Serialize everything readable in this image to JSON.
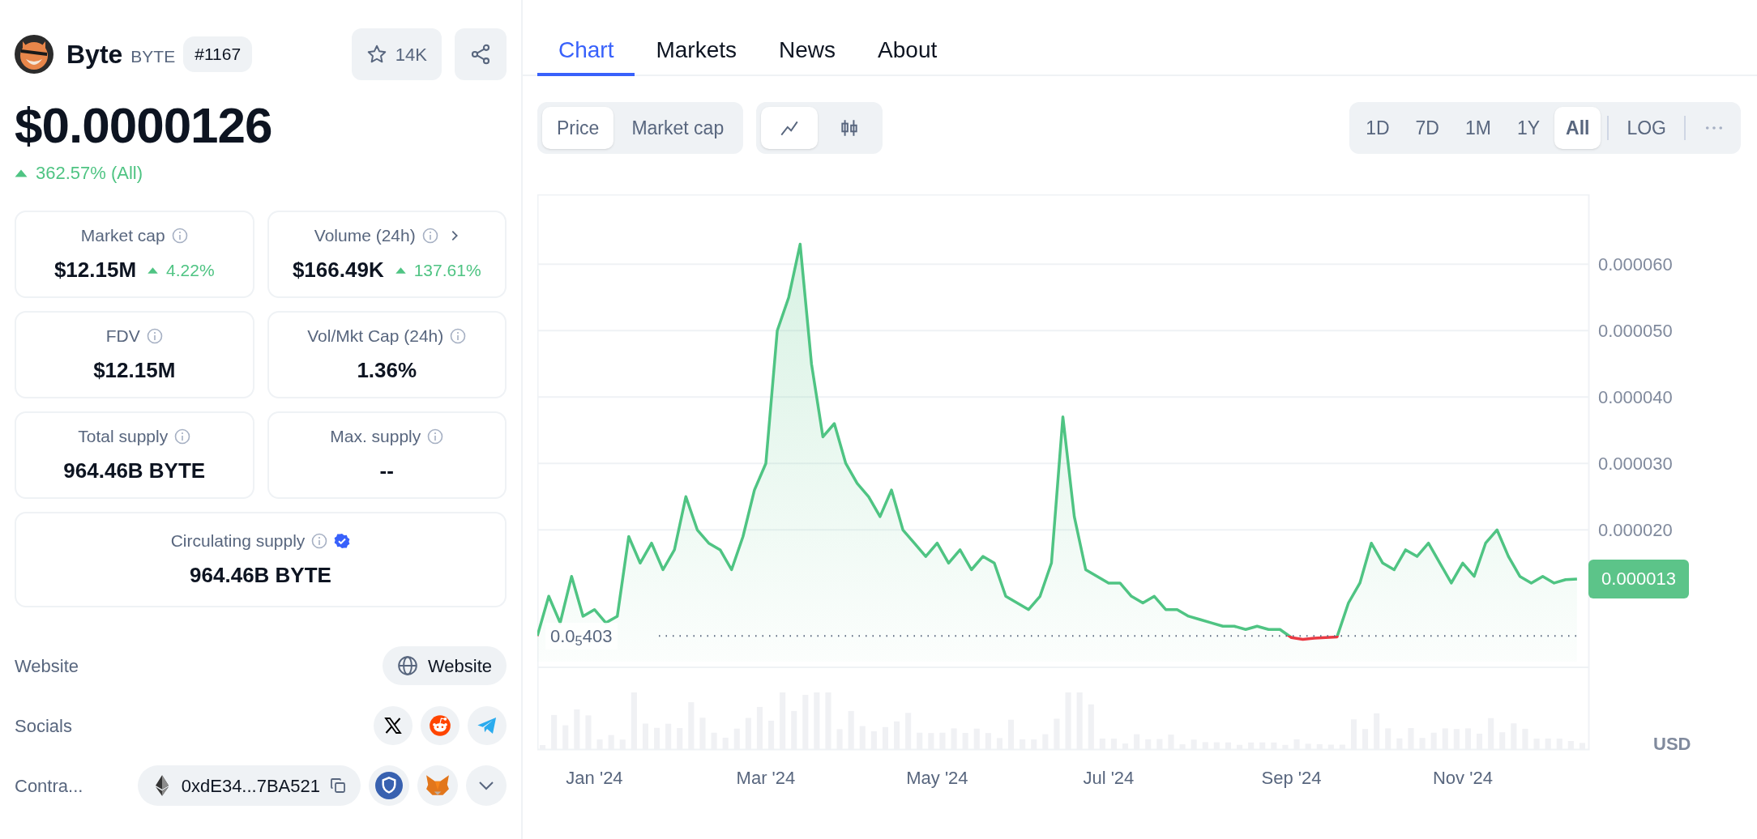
{
  "coin": {
    "name": "Byte",
    "symbol": "BYTE",
    "rank": "#1167",
    "watchlist_count": "14K"
  },
  "price": {
    "value": "$0.0000126",
    "change": "362.57% (All)",
    "rising": true
  },
  "stats": [
    {
      "kind": "half",
      "label": "Market cap",
      "value": "$12.15M",
      "change": "4.22%",
      "rising": true,
      "expandable": false,
      "verified": false
    },
    {
      "kind": "half",
      "label": "Volume (24h)",
      "value": "$166.49K",
      "change": "137.61%",
      "rising": true,
      "expandable": true,
      "verified": false
    },
    {
      "kind": "half",
      "label": "FDV",
      "value": "$12.15M",
      "expandable": false,
      "verified": false
    },
    {
      "kind": "half",
      "label": "Vol/Mkt Cap (24h)",
      "value": "1.36%",
      "expandable": false,
      "verified": false
    },
    {
      "kind": "half",
      "label": "Total supply",
      "value": "964.46B BYTE",
      "expandable": false,
      "verified": false
    },
    {
      "kind": "half",
      "label": "Max. supply",
      "value": "--",
      "expandable": false,
      "verified": false
    },
    {
      "kind": "wide",
      "label": "Circulating supply",
      "value": "964.46B BYTE",
      "expandable": false,
      "verified": true
    }
  ],
  "links": [
    {
      "kind": "website",
      "label": "Website",
      "button": "Website"
    },
    {
      "kind": "socials",
      "label": "Socials"
    },
    {
      "kind": "contract",
      "label": "Contra...",
      "address": "0xdE34...7BA521"
    }
  ],
  "tabs": [
    {
      "label": "Chart",
      "selected": true
    },
    {
      "label": "Markets",
      "selected": false
    },
    {
      "label": "News",
      "selected": false
    },
    {
      "label": "About",
      "selected": false
    }
  ],
  "metric_toggle": [
    {
      "label": "Price",
      "selected": true
    },
    {
      "label": "Market cap",
      "selected": false
    }
  ],
  "style_toggle": [
    {
      "kind": "line",
      "selected": true
    },
    {
      "kind": "candle",
      "selected": false
    }
  ],
  "ranges": [
    {
      "label": "1D",
      "selected": false
    },
    {
      "label": "7D",
      "selected": false
    },
    {
      "label": "1M",
      "selected": false
    },
    {
      "label": "1Y",
      "selected": false
    },
    {
      "label": "All",
      "selected": true
    }
  ],
  "log_toggle": {
    "label": "LOG",
    "on": false
  },
  "currency": "USD",
  "chart_labels": {
    "start": "0.0$_{5}$403",
    "last": "0.000013"
  },
  "chart_data": {
    "type": "area",
    "ylim": [
      -1.3e-05,
      7.05e-05
    ],
    "grid": true,
    "categories": [
      null,
      null,
      null,
      null,
      null,
      "Jan '24",
      null,
      null,
      null,
      null,
      null,
      null,
      null,
      null,
      null,
      null,
      null,
      null,
      null,
      null,
      "Mar '24",
      null,
      null,
      null,
      null,
      null,
      null,
      null,
      null,
      null,
      null,
      null,
      null,
      null,
      null,
      "May '24",
      null,
      null,
      null,
      null,
      null,
      null,
      null,
      null,
      null,
      null,
      null,
      null,
      null,
      null,
      "Jul '24",
      null,
      null,
      null,
      null,
      null,
      null,
      null,
      null,
      null,
      null,
      null,
      null,
      null,
      null,
      null,
      "Sep '24",
      null,
      null,
      null,
      null,
      null,
      null,
      null,
      null,
      null,
      null,
      null,
      null,
      null,
      null,
      "Nov '24",
      null,
      null,
      null,
      null,
      null,
      null,
      null,
      null,
      null,
      null
    ],
    "yticks": [
      {
        "value": 2e-05,
        "label": "0.000020"
      },
      {
        "value": 3e-05,
        "label": "0.000030"
      },
      {
        "value": 4e-05,
        "label": "0.000040"
      },
      {
        "value": 5e-05,
        "label": "0.000050"
      },
      {
        "value": 6e-05,
        "label": "0.000060"
      }
    ],
    "series": [
      {
        "color": "#4fc483",
        "values": [
          4.03e-06,
          1e-05,
          6e-06,
          1.3e-05,
          7e-06,
          8e-06,
          6e-06,
          7e-06,
          1.9e-05,
          1.5e-05,
          1.8e-05,
          1.4e-05,
          1.7e-05,
          2.5e-05,
          2e-05,
          1.8e-05,
          1.7e-05,
          1.4e-05,
          1.9e-05,
          2.6e-05,
          3e-05,
          5e-05,
          5.5e-05,
          6.3e-05,
          4.5e-05,
          3.4e-05,
          3.6e-05,
          3e-05,
          2.7e-05,
          2.5e-05,
          2.2e-05,
          2.6e-05,
          2e-05,
          1.8e-05,
          1.6e-05,
          1.8e-05,
          1.5e-05,
          1.7e-05,
          1.4e-05,
          1.6e-05,
          1.5e-05,
          1e-05,
          9e-06,
          8e-06,
          1e-05,
          1.5e-05,
          3.7e-05,
          2.2e-05,
          1.4e-05,
          1.3e-05,
          1.2e-05,
          1.2e-05,
          1e-05,
          9e-06,
          1e-05,
          8e-06,
          8e-06,
          7e-06,
          6.5e-06,
          6e-06,
          5.5e-06,
          5.5e-06,
          5e-06,
          5.5e-06,
          5e-06,
          5e-06,
          3.8e-06,
          3.5e-06,
          3.7e-06,
          3.8e-06,
          3.9e-06,
          9e-06,
          1.2e-05,
          1.8e-05,
          1.5e-05,
          1.4e-05,
          1.7e-05,
          1.6e-05,
          1.8e-05,
          1.5e-05,
          1.2e-05,
          1.5e-05,
          1.3e-05,
          1.8e-05,
          2e-05,
          1.6e-05,
          1.3e-05,
          1.2e-05,
          1.3e-05,
          1.2e-05,
          1.25e-05,
          1.26e-05
        ]
      }
    ]
  }
}
